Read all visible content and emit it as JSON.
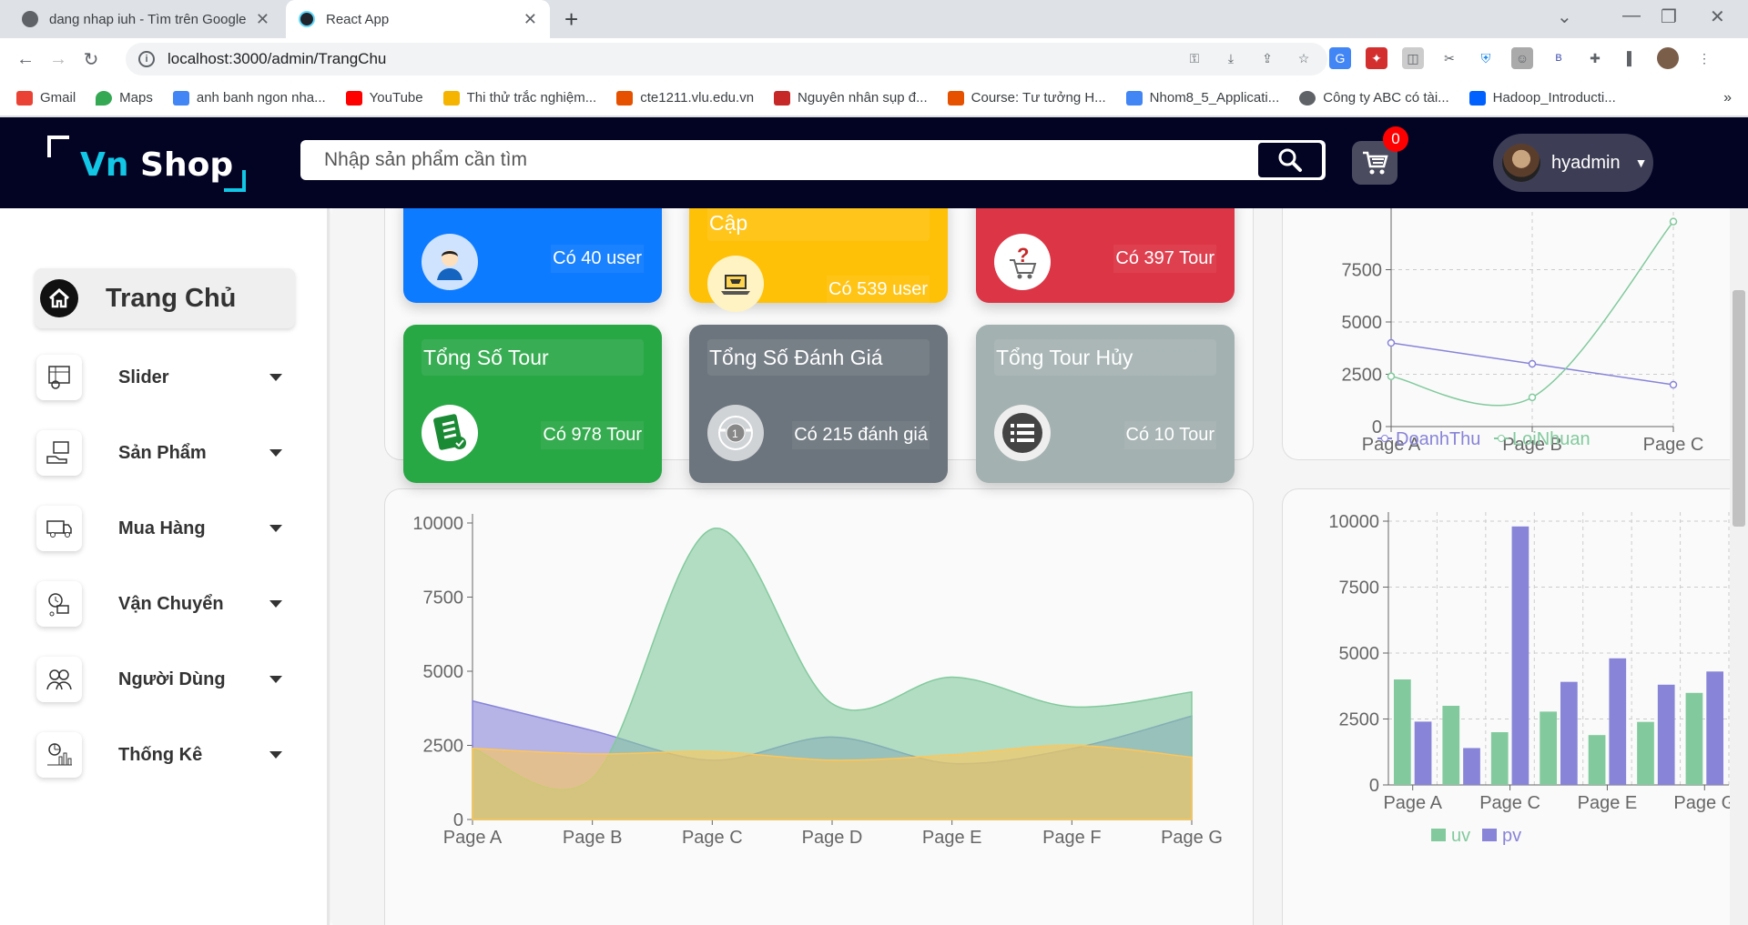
{
  "browser": {
    "tabs": [
      {
        "title": "dang nhap iuh - Tìm trên Google",
        "active": false
      },
      {
        "title": "React App",
        "active": true
      }
    ],
    "url": "localhost:3000/admin/TrangChu",
    "bookmarks": [
      {
        "label": "Gmail",
        "color": "#ea4335"
      },
      {
        "label": "Maps",
        "color": "#34a853"
      },
      {
        "label": "anh banh ngon nha...",
        "color": "#4285f4"
      },
      {
        "label": "YouTube",
        "color": "#ff0000"
      },
      {
        "label": "Thi thử trắc nghiệm...",
        "color": "#f4b400"
      },
      {
        "label": "cte1211.vlu.edu.vn",
        "color": "#e65100"
      },
      {
        "label": "Nguyên nhân sụp đ...",
        "color": "#c62828"
      },
      {
        "label": "Course: Tư tưởng H...",
        "color": "#e65100"
      },
      {
        "label": "Nhom8_5_Applicati...",
        "color": "#4285f4"
      },
      {
        "label": "Công ty ABC có tài...",
        "color": "#5f6368"
      },
      {
        "label": "Hadoop_Introducti...",
        "color": "#0061ff"
      }
    ]
  },
  "header": {
    "logo_vn": "Vn",
    "logo_shop": "Shop",
    "search_placeholder": "Nhập sản phẩm cần tìm",
    "cart_count": "0",
    "username": "hyadmin"
  },
  "sidebar": {
    "home_label": "Trang Chủ",
    "items": [
      {
        "label": "Slider",
        "icon": "slider-icon"
      },
      {
        "label": "Sản Phẩm",
        "icon": "product-icon"
      },
      {
        "label": "Mua Hàng",
        "icon": "purchase-icon"
      },
      {
        "label": "Vận Chuyển",
        "icon": "shipping-icon"
      },
      {
        "label": "Người Dùng",
        "icon": "users-icon"
      },
      {
        "label": "Thống Kê",
        "icon": "statistics-icon"
      }
    ]
  },
  "cards": [
    {
      "title": "",
      "count": "Có 40 user",
      "color": "#0d7bff",
      "icon": "user-avatar-icon"
    },
    {
      "title": "Cập",
      "count": "Có 539 user",
      "color": "#ffc107",
      "icon": "laptop-cart-icon"
    },
    {
      "title": "",
      "count": "Có 397 Tour",
      "color": "#dc3545",
      "icon": "question-cart-icon"
    },
    {
      "title": "Tổng Số Tour",
      "count": "Có 978 Tour",
      "color": "#28a745",
      "icon": "list-check-icon"
    },
    {
      "title": "Tổng Số Đánh Giá",
      "count": "Có 215 đánh giá",
      "color": "#6c757d",
      "icon": "award-badge-icon"
    },
    {
      "title": "Tổng Tour Hủy",
      "count": "Có 10 Tour",
      "color": "#a3b1b0",
      "icon": "list-icon"
    }
  ],
  "chart_data": [
    {
      "type": "line",
      "categories": [
        "Page A",
        "Page B",
        "Page C"
      ],
      "series": [
        {
          "name": "DoanhThu",
          "color": "#8884d8",
          "values": [
            4000,
            3000,
            2000
          ]
        },
        {
          "name": "LoiNhuan",
          "color": "#82ca9d",
          "values": [
            2400,
            1398,
            9800
          ]
        }
      ],
      "yticks": [
        0,
        2500,
        5000,
        7500
      ],
      "ylim": [
        0,
        10000
      ]
    },
    {
      "type": "area",
      "categories": [
        "Page A",
        "Page B",
        "Page C",
        "Page D",
        "Page E",
        "Page F",
        "Page G"
      ],
      "series": [
        {
          "color": "#8884d8",
          "values": [
            4000,
            3000,
            2000,
            2780,
            1890,
            2390,
            3490
          ]
        },
        {
          "color": "#82ca9d",
          "values": [
            2400,
            1398,
            9800,
            3908,
            4800,
            3800,
            4300
          ]
        },
        {
          "color": "#ffc658",
          "values": [
            2400,
            2210,
            2290,
            2000,
            2181,
            2500,
            2100
          ]
        }
      ],
      "yticks": [
        0,
        2500,
        5000,
        7500,
        10000
      ],
      "ylim": [
        0,
        10000
      ]
    },
    {
      "type": "bar",
      "categories": [
        "Page A",
        "Page B",
        "Page C",
        "Page D",
        "Page E",
        "Page F",
        "Page G"
      ],
      "xtick_labels": [
        "Page A",
        "Page C",
        "Page E",
        "Page G"
      ],
      "series": [
        {
          "name": "uv",
          "color": "#82ca9d",
          "values": [
            4000,
            3000,
            2000,
            2780,
            1890,
            2390,
            3490
          ]
        },
        {
          "name": "pv",
          "color": "#8884d8",
          "values": [
            2400,
            1398,
            9800,
            3908,
            4800,
            3800,
            4300
          ]
        }
      ],
      "yticks": [
        0,
        2500,
        5000,
        7500,
        10000
      ],
      "ylim": [
        0,
        10000
      ]
    }
  ]
}
